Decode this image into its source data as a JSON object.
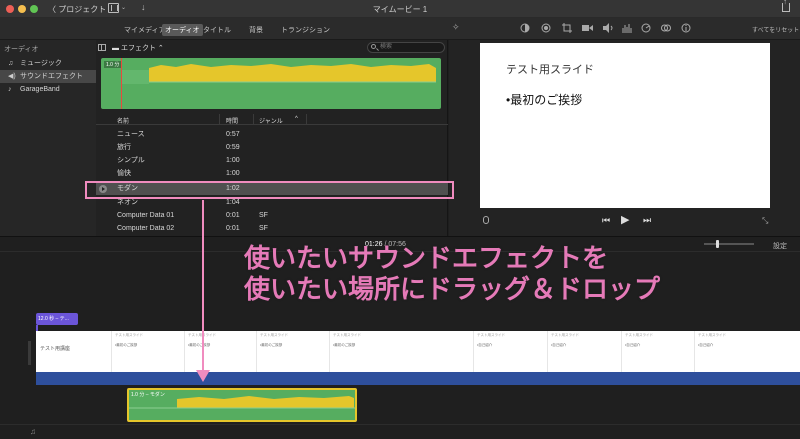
{
  "window": {
    "back_label": "〈 プロジェクト",
    "title": "マイムービー 1"
  },
  "tabs": [
    "マイメディア",
    "オーディオ",
    "タイトル",
    "背景",
    "トランジション"
  ],
  "active_tab_index": 1,
  "toolbar": {
    "reset_all_label": "すべてをリセット"
  },
  "sidebar": {
    "heading": "オーディオ",
    "items": [
      {
        "label": "ミュージック",
        "icon": "music-note-icon"
      },
      {
        "label": "サウンドエフェクト",
        "icon": "speaker-icon"
      },
      {
        "label": "GarageBand",
        "icon": "guitar-icon"
      }
    ],
    "selected_index": 1
  },
  "browser": {
    "folder_label": "エフェクト ⌃",
    "search_placeholder": "検索",
    "preview_duration": "1.0 分",
    "columns": [
      "名前",
      "時間",
      "ジャンル"
    ],
    "rows": [
      {
        "name": "ニュース",
        "time": "0:57",
        "genre": ""
      },
      {
        "name": "旅行",
        "time": "0:59",
        "genre": ""
      },
      {
        "name": "シンプル",
        "time": "1:00",
        "genre": ""
      },
      {
        "name": "愉快",
        "time": "1:00",
        "genre": ""
      },
      {
        "name": "モダン",
        "time": "1:02",
        "genre": ""
      },
      {
        "name": "ネオン",
        "time": "1:04",
        "genre": ""
      },
      {
        "name": "Computer Data 01",
        "time": "0:01",
        "genre": "SF"
      },
      {
        "name": "Computer Data 02",
        "time": "0:01",
        "genre": "SF"
      }
    ],
    "selected_row_index": 4
  },
  "viewer": {
    "slide_title": "テスト用スライド",
    "slide_bullet": "•最初のご挨拶"
  },
  "timeline": {
    "current_time": "01:26",
    "separator": " / ",
    "total_time": "07:56",
    "settings_label": "設定",
    "title_clip_label": "12.0 秒 – テ...",
    "video_first_label": "テスト用講座",
    "frames": [
      {
        "t": "テスト用スライド",
        "b": "•最初のご挨拶"
      },
      {
        "t": "テスト用スライド",
        "b": "•最初のご挨拶"
      },
      {
        "t": "テスト用スライド",
        "b": "•最初のご挨拶"
      },
      {
        "t": "テスト用スライド",
        "b": "•最初のご挨拶"
      },
      {
        "t": "テスト用スライド",
        "b": "•自己紹介"
      },
      {
        "t": "テスト用スライド",
        "b": "•自己紹介"
      },
      {
        "t": "テスト用スライド",
        "b": "•自己紹介"
      },
      {
        "t": "テスト用スライド",
        "b": "•自己紹介"
      }
    ],
    "sfx_clip_label": "1.0 分 – モダン"
  },
  "annotation": {
    "line1": "使いたいサウンドエフェクトを",
    "line2": "使いたい場所にドラッグ＆ドロップ",
    "color": "#e57ab8"
  },
  "colors": {
    "audio_clip": "#56ad60",
    "audio_peak": "#e5c62b",
    "title_clip": "#6b55d8",
    "video_audio_band": "#2e4f9c"
  }
}
